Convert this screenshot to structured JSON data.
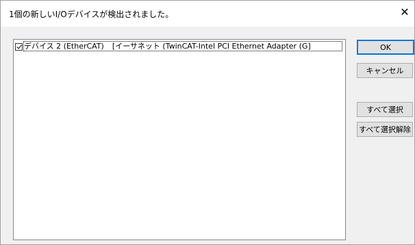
{
  "window": {
    "title": "1個の新しいI/Oデバイスが検出されました。",
    "close_glyph": "✕"
  },
  "device_list": {
    "items": [
      {
        "checked": true,
        "name": "デバイス 2 (EtherCAT)",
        "description": "[イーサネット (TwinCAT-Intel PCI Ethernet Adapter (G]"
      }
    ]
  },
  "buttons": {
    "ok": "OK",
    "cancel": "キャンセル",
    "select_all": "すべて選択",
    "deselect_all": "すべて選択解除"
  },
  "colors": {
    "accent": "#0078d7",
    "background": "#f0f0f0"
  }
}
